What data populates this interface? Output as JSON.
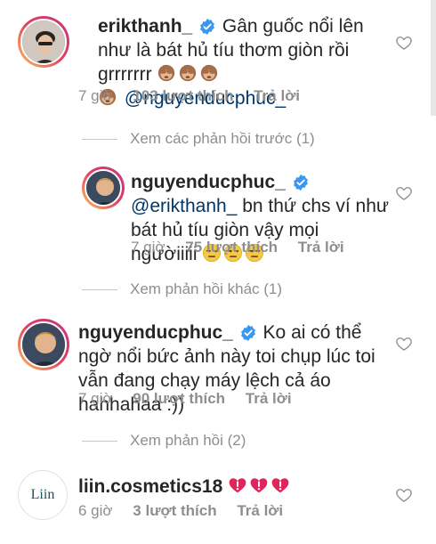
{
  "comments": [
    {
      "username": "erikthanh_",
      "text": "Gân guốc nổi lên như là bát hủ tíu thơm  giòn rồi grrrrrrr",
      "mention": "@nguyenducphuc_",
      "time": "7 giờ",
      "likes": "103 lượt thích",
      "reply": "Trả lời"
    },
    {
      "username": "nguyenducphuc_",
      "mention": "@erikthanh_",
      "text": "bn thứ chs ví như bát hủ tíu giòn vậy mọi ngườiiiii",
      "time": "7 giờ",
      "likes": "75 lượt thích",
      "reply": "Trả lời"
    },
    {
      "username": "nguyenducphuc_",
      "text": "Ko ai có thể ngờ nổi bức ảnh này toi chụp lúc toi vẫn đang chạy máy lệch cả áo hahhahaa :))",
      "time": "7 giờ",
      "likes": "90 lượt thích",
      "reply": "Trả lời"
    },
    {
      "username": "liin.cosmetics18",
      "avatar_text": "Liin",
      "time": "6 giờ",
      "likes": "3 lượt thích",
      "reply": "Trả lời"
    }
  ],
  "threads": {
    "previous_replies": "Xem các phản hồi trước (1)",
    "other_replies": "Xem phản hồi khác (1)",
    "view_replies": "Xem phản hồi (2)"
  },
  "colors": {
    "verified": "#3897f0",
    "mention": "#00376b",
    "meta": "#8e8e8e",
    "heart_emoji": "#e0245e"
  },
  "icons": {
    "like": "heart-outline-icon",
    "monkey": "see-no-evil-monkey-emoji",
    "unamused": "unamused-face-emoji",
    "heart_exclamation": "heart-exclamation-emoji"
  }
}
